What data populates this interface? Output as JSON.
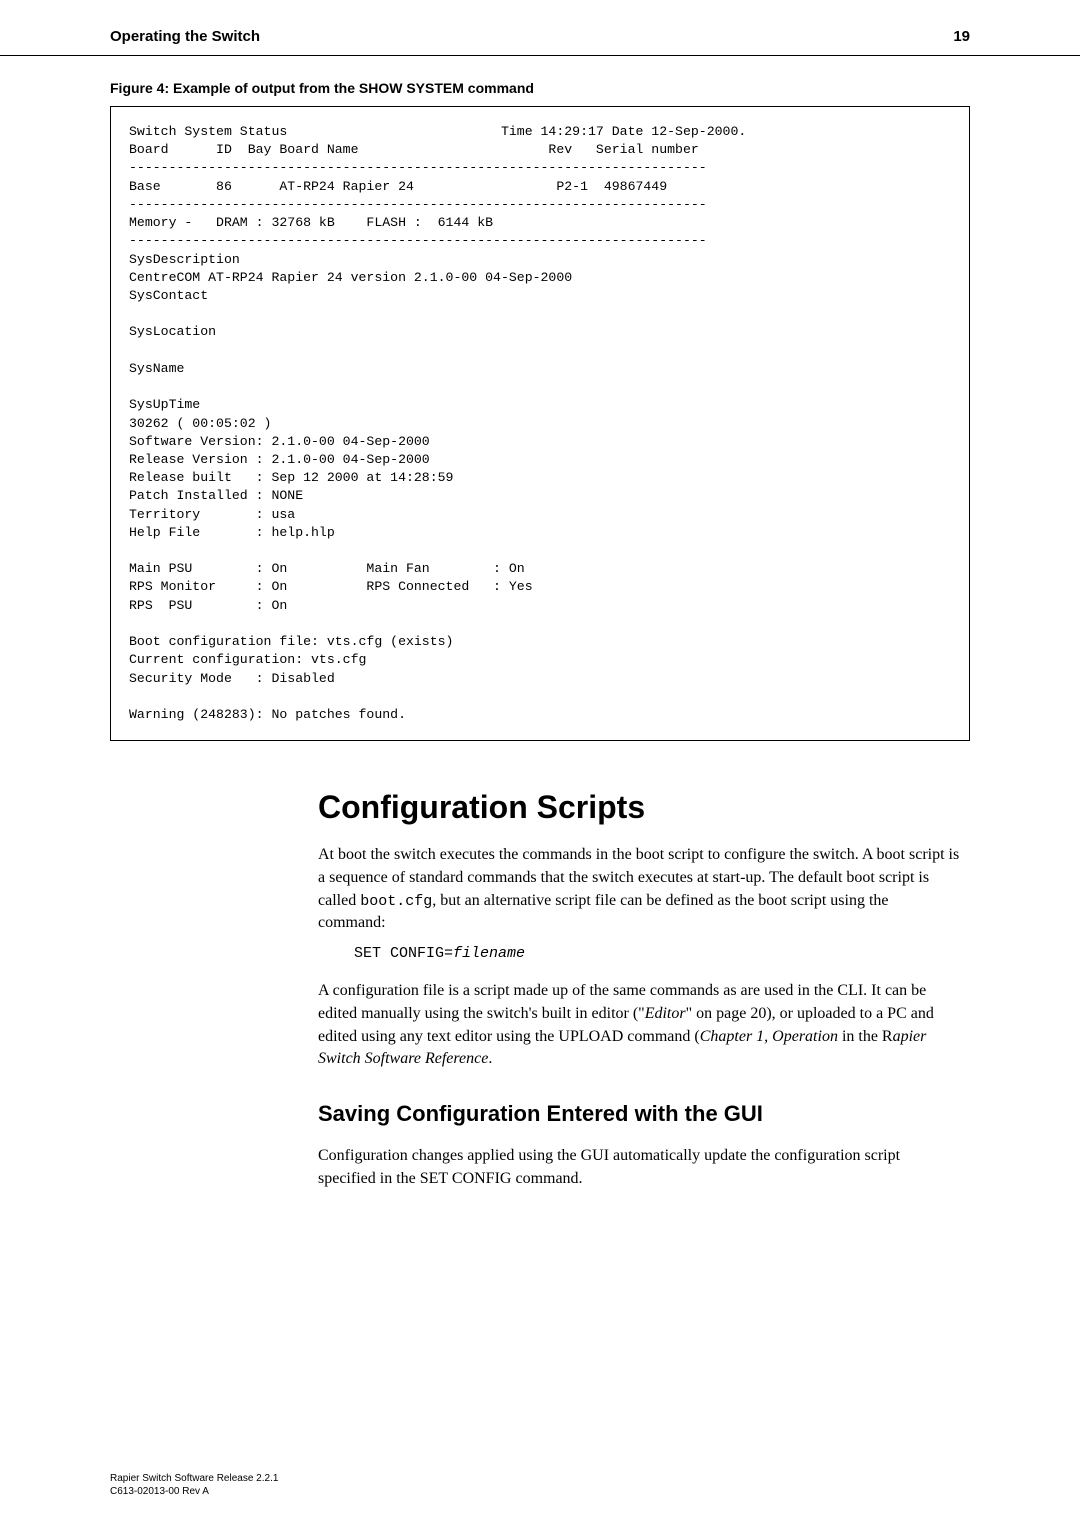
{
  "header": {
    "title": "Operating the Switch",
    "page": "19"
  },
  "figure_caption": "Figure 4: Example of output from the SHOW SYSTEM command",
  "terminal_output": "Switch System Status                           Time 14:29:17 Date 12-Sep-2000.\nBoard      ID  Bay Board Name                        Rev   Serial number\n-------------------------------------------------------------------------\nBase       86      AT-RP24 Rapier 24                  P2-1  49867449\n-------------------------------------------------------------------------\nMemory -   DRAM : 32768 kB    FLASH :  6144 kB\n-------------------------------------------------------------------------\nSysDescription\nCentreCOM AT-RP24 Rapier 24 version 2.1.0-00 04-Sep-2000\nSysContact\n\nSysLocation\n\nSysName\n\nSysUpTime\n30262 ( 00:05:02 )\nSoftware Version: 2.1.0-00 04-Sep-2000\nRelease Version : 2.1.0-00 04-Sep-2000\nRelease built   : Sep 12 2000 at 14:28:59\nPatch Installed : NONE\nTerritory       : usa\nHelp File       : help.hlp\n\nMain PSU        : On          Main Fan        : On\nRPS Monitor     : On          RPS Connected   : Yes\nRPS  PSU        : On\n\nBoot configuration file: vts.cfg (exists)\nCurrent configuration: vts.cfg\nSecurity Mode   : Disabled\n\nWarning (248283): No patches found.",
  "section": {
    "heading": "Configuration Scripts",
    "paragraph1_a": "At boot the switch executes the commands in the boot script to configure the switch. A boot script is a sequence of standard commands that the switch executes at start-up. The default boot script is called ",
    "paragraph1_code": "boot.cfg",
    "paragraph1_b": ", but an alternative script file can be defined as the boot script using the command:",
    "code_line_a": "SET CONFIG=",
    "code_line_b": "filename",
    "paragraph2_a": "A configuration file is a script made up of the same commands as are used in the CLI. It can be edited manually using the switch's built in editor (\"",
    "paragraph2_em1": "Editor",
    "paragraph2_b": "\" on page 20), or uploaded to a PC and edited using any text editor using the UPLOAD command (",
    "paragraph2_em2": "Chapter 1, Operation",
    "paragraph2_c": " in the R",
    "paragraph2_em3": "apier Switch Software Reference",
    "paragraph2_d": "."
  },
  "subsection": {
    "heading": "Saving Configuration Entered with the GUI",
    "paragraph": "Configuration changes applied using the GUI automatically update the configuration script specified in the SET CONFIG command."
  },
  "footer": {
    "line1": "Rapier Switch Software Release 2.2.1",
    "line2": "C613-02013-00 Rev A"
  }
}
